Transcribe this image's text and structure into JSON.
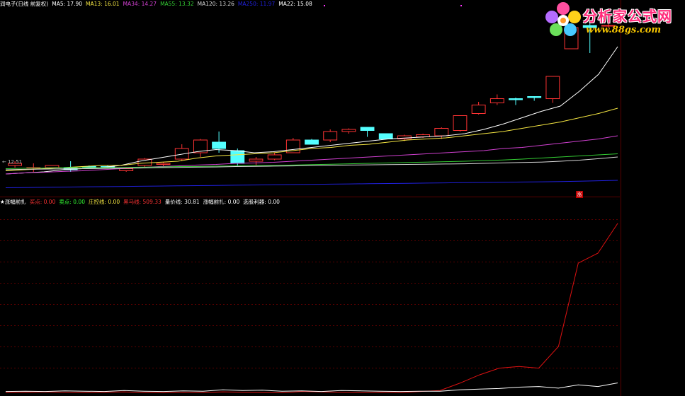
{
  "top_header": {
    "stock_name": "润电子(日线 前复权)",
    "indicators": [
      {
        "label": "MA5: 17.90",
        "color": "#ffffff"
      },
      {
        "label": "MA13: 16.01",
        "color": "#f5e642"
      },
      {
        "label": "MA34: 14.27",
        "color": "#d040d0"
      },
      {
        "label": "MA55: 13.32",
        "color": "#33cc33"
      },
      {
        "label": "MA120: 13.26",
        "color": "#d8d8d8"
      },
      {
        "label": "MA250: 11.97",
        "color": "#2020dd"
      },
      {
        "label": "MA22: 15.08",
        "color": "#ffffff"
      }
    ]
  },
  "price_tag": "← 12.51",
  "zhang_badge": "涨",
  "sub_header": {
    "title": "★涨幅前扎",
    "indicators": [
      {
        "label": "买点: 0.00",
        "color": "#ff3333"
      },
      {
        "label": "卖点: 0.00",
        "color": "#33ff33"
      },
      {
        "label": "庄控线: 0.00",
        "color": "#f5e642"
      },
      {
        "label": "黑马线: 509.33",
        "color": "#ff3333"
      },
      {
        "label": "量价线: 30.81",
        "color": "#ffffff"
      },
      {
        "label": "涨幅前扎: 0.00",
        "color": "#ffffff"
      },
      {
        "label": "选股利器: 0.00",
        "color": "#ffffff"
      }
    ]
  },
  "logo": {
    "title": "分析家公式网",
    "url": "www.88gs.com"
  },
  "colors": {
    "background": "#000000",
    "up_candle": "#ff3333",
    "down_candle": "#54ffff",
    "grid": "#5a0000"
  },
  "chart_data": [
    {
      "type": "candlestick",
      "candles": [
        {
          "o": 12.6,
          "c": 12.7,
          "h": 12.8,
          "l": 12.5
        },
        {
          "o": 12.5,
          "c": 12.5,
          "h": 12.7,
          "l": 12.3
        },
        {
          "o": 12.5,
          "c": 12.6,
          "h": 12.6,
          "l": 12.45
        },
        {
          "o": 12.5,
          "c": 12.4,
          "h": 12.8,
          "l": 12.3
        },
        {
          "o": 12.55,
          "c": 12.5,
          "h": 12.6,
          "l": 12.45
        },
        {
          "o": 12.55,
          "c": 12.5,
          "h": 12.6,
          "l": 12.45
        },
        {
          "o": 12.35,
          "c": 12.45,
          "h": 12.5,
          "l": 12.3
        },
        {
          "o": 12.6,
          "c": 12.9,
          "h": 12.95,
          "l": 12.5
        },
        {
          "o": 12.65,
          "c": 12.7,
          "h": 12.75,
          "l": 12.5
        },
        {
          "o": 12.9,
          "c": 13.4,
          "h": 13.6,
          "l": 12.8
        },
        {
          "o": 13.2,
          "c": 13.8,
          "h": 13.85,
          "l": 13.0
        },
        {
          "o": 13.7,
          "c": 13.4,
          "h": 14.2,
          "l": 13.2
        },
        {
          "o": 13.3,
          "c": 12.7,
          "h": 13.4,
          "l": 12.6
        },
        {
          "o": 12.8,
          "c": 12.9,
          "h": 13.0,
          "l": 12.6
        },
        {
          "o": 12.9,
          "c": 13.1,
          "h": 13.2,
          "l": 12.85
        },
        {
          "o": 13.2,
          "c": 13.8,
          "h": 13.9,
          "l": 13.2
        },
        {
          "o": 13.8,
          "c": 13.6,
          "h": 13.85,
          "l": 13.6
        },
        {
          "o": 13.8,
          "c": 14.2,
          "h": 14.3,
          "l": 13.7
        },
        {
          "o": 14.2,
          "c": 14.3,
          "h": 14.35,
          "l": 14.1
        },
        {
          "o": 14.4,
          "c": 14.25,
          "h": 14.4,
          "l": 13.95
        },
        {
          "o": 14.1,
          "c": 13.85,
          "h": 14.1,
          "l": 13.85
        },
        {
          "o": 13.85,
          "c": 14.0,
          "h": 14.05,
          "l": 13.75
        },
        {
          "o": 13.95,
          "c": 14.05,
          "h": 14.1,
          "l": 13.9
        },
        {
          "o": 14.0,
          "c": 14.35,
          "h": 14.4,
          "l": 13.85
        },
        {
          "o": 14.25,
          "c": 14.95,
          "h": 14.95,
          "l": 14.2
        },
        {
          "o": 15.05,
          "c": 15.45,
          "h": 15.6,
          "l": 15.0
        },
        {
          "o": 15.55,
          "c": 15.75,
          "h": 15.95,
          "l": 15.45
        },
        {
          "o": 15.75,
          "c": 15.7,
          "h": 15.8,
          "l": 15.45
        },
        {
          "o": 15.85,
          "c": 15.8,
          "h": 15.85,
          "l": 15.65
        },
        {
          "o": 15.75,
          "c": 16.8,
          "h": 16.8,
          "l": 15.55
        },
        {
          "o": 18.1,
          "c": 19.1,
          "h": 19.3,
          "l": 18.1
        },
        {
          "o": 19.2,
          "c": 19.1,
          "h": 19.3,
          "l": 17.9
        },
        {
          "o": 19.2,
          "c": 19.2,
          "h": 19.3,
          "l": 19.1
        }
      ],
      "ma_lines": [
        {
          "name": "MA5",
          "color": "#ffffff",
          "values": [
            12.2,
            12.25,
            12.3,
            12.4,
            12.45,
            12.5,
            12.6,
            12.8,
            12.95,
            13.1,
            13.25,
            13.35,
            13.3,
            13.2,
            13.25,
            13.35,
            13.45,
            13.55,
            13.65,
            13.75,
            13.85,
            13.9,
            13.95,
            14.0,
            14.1,
            14.3,
            14.55,
            14.85,
            15.15,
            15.4,
            16.1,
            16.9,
            18.2
          ]
        },
        {
          "name": "MA13",
          "color": "#f5e642",
          "values": [
            12.35,
            12.4,
            12.45,
            12.5,
            12.55,
            12.6,
            12.6,
            12.7,
            12.75,
            12.8,
            12.95,
            13.05,
            13.1,
            13.15,
            13.2,
            13.3,
            13.4,
            13.45,
            13.55,
            13.6,
            13.7,
            13.8,
            13.85,
            13.9,
            14.0,
            14.1,
            14.2,
            14.35,
            14.5,
            14.65,
            14.85,
            15.05,
            15.3
          ]
        },
        {
          "name": "MA34",
          "color": "#d040d0",
          "values": [
            12.2,
            12.25,
            12.28,
            12.32,
            12.35,
            12.4,
            12.45,
            12.5,
            12.55,
            12.58,
            12.62,
            12.65,
            12.7,
            12.72,
            12.75,
            12.8,
            12.85,
            12.9,
            12.95,
            13.0,
            13.05,
            13.1,
            13.15,
            13.2,
            13.25,
            13.3,
            13.4,
            13.45,
            13.55,
            13.65,
            13.75,
            13.85,
            14.0
          ]
        },
        {
          "name": "MA55",
          "color": "#33cc33",
          "values": [
            12.45,
            12.47,
            12.48,
            12.5,
            12.5,
            12.5,
            12.5,
            12.52,
            12.53,
            12.55,
            12.55,
            12.57,
            12.58,
            12.6,
            12.6,
            12.62,
            12.64,
            12.66,
            12.68,
            12.7,
            12.72,
            12.74,
            12.76,
            12.78,
            12.8,
            12.83,
            12.86,
            12.9,
            12.95,
            13.0,
            13.05,
            13.1,
            13.15
          ]
        },
        {
          "name": "MA120",
          "color": "#d8d8d8",
          "values": [
            12.4,
            12.42,
            12.43,
            12.44,
            12.45,
            12.46,
            12.47,
            12.48,
            12.5,
            12.51,
            12.52,
            12.53,
            12.55,
            12.56,
            12.57,
            12.58,
            12.6,
            12.61,
            12.62,
            12.63,
            12.64,
            12.65,
            12.66,
            12.67,
            12.68,
            12.7,
            12.72,
            12.74,
            12.76,
            12.8,
            12.85,
            12.92,
            13.0
          ]
        },
        {
          "name": "MA250",
          "color": "#2020dd",
          "values": [
            11.55,
            11.56,
            11.57,
            11.58,
            11.59,
            11.6,
            11.61,
            11.62,
            11.63,
            11.64,
            11.65,
            11.66,
            11.67,
            11.68,
            11.69,
            11.7,
            11.71,
            11.72,
            11.73,
            11.74,
            11.75,
            11.76,
            11.77,
            11.78,
            11.79,
            11.8,
            11.81,
            11.82,
            11.83,
            11.84,
            11.86,
            11.88,
            11.9
          ]
        }
      ],
      "ylim": [
        11.2,
        20.0
      ]
    },
    {
      "type": "line",
      "series": [
        {
          "name": "黑马线",
          "color": "#dd1111",
          "values": [
            2,
            3,
            4,
            3,
            2,
            3,
            4,
            2,
            1,
            3,
            2,
            4,
            3,
            2,
            1,
            5,
            4,
            3,
            2,
            3,
            2,
            5,
            8,
            30,
            55,
            75,
            80,
            75,
            140,
            390,
            420,
            509.33
          ]
        },
        {
          "name": "量价线",
          "color": "#ffffff",
          "values": [
            5,
            6,
            5,
            7,
            6,
            5,
            8,
            6,
            5,
            7,
            6,
            10,
            8,
            9,
            6,
            7,
            5,
            8,
            7,
            6,
            5,
            6,
            6,
            10,
            12,
            14,
            18,
            20,
            15,
            25,
            20,
            30.81
          ]
        }
      ],
      "ylim": [
        0,
        560
      ]
    }
  ]
}
